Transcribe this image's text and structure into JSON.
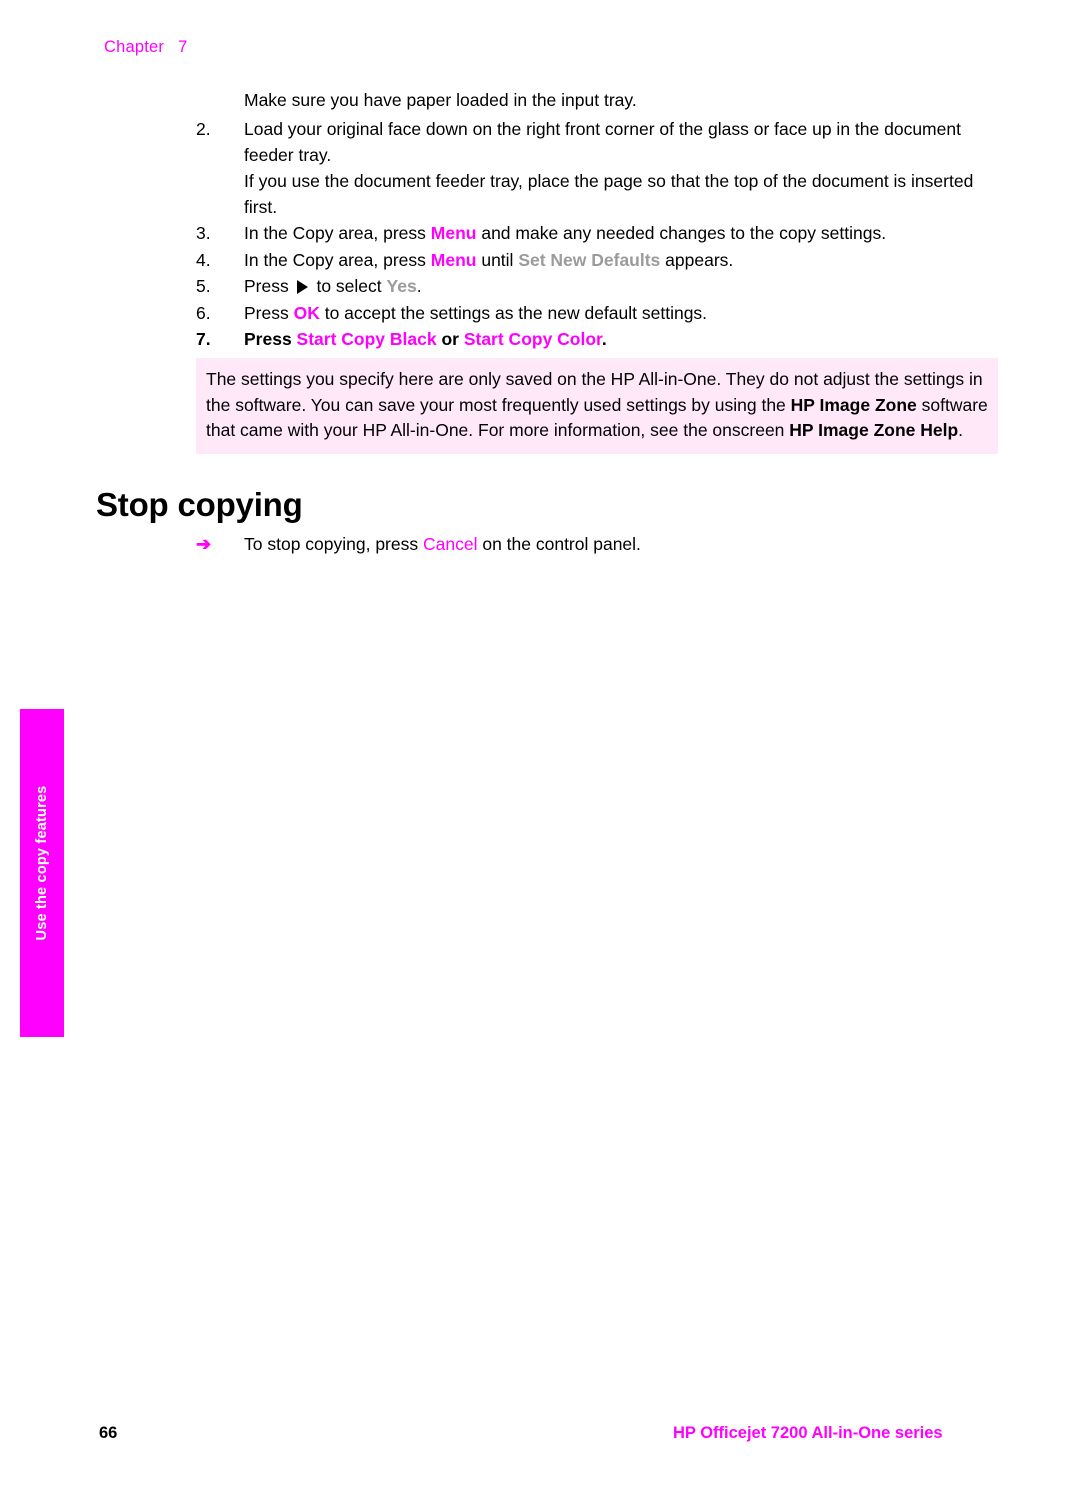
{
  "header": {
    "chapter_label": "Chapter",
    "chapter_number": "7"
  },
  "main": {
    "lead_line": "Make sure you have paper loaded in the input tray.",
    "steps": [
      {
        "marker": "2.",
        "text_before": "Load your original face down on the right front corner of the glass or face up in the document feeder tray.",
        "sub_para": "If you use the document feeder tray, place the page so that the top of the document is inserted first."
      },
      {
        "marker": "3.",
        "pre": "In the Copy area, press ",
        "key": "Menu",
        "post": " and make any needed changes to the copy settings."
      },
      {
        "marker": "4.",
        "pre": "In the Copy area, press ",
        "key": "Menu",
        "mid": " until ",
        "key2": "Set New Defaults",
        "post": " appears."
      },
      {
        "marker": "5.",
        "pre": "Press ",
        "arrow_icon": "right-arrow-key-icon",
        "mid": " to select ",
        "key2": "Yes",
        "post": "."
      },
      {
        "marker": "6.",
        "pre": "Press ",
        "key": "OK",
        "post": " to accept the settings as the new default settings."
      },
      {
        "marker": "7.",
        "pre": "Press ",
        "key": "Start Copy Black",
        "mid": " or ",
        "key2": "Start Copy Color",
        "post": "."
      }
    ]
  },
  "note": {
    "part1": "The settings you specify here are only saved on the HP All-in-One. They do not adjust the settings in the software. You can save your most frequently used settings by using the ",
    "bold1": "HP Image Zone",
    "part2": " software that came with your HP All-in-One. For more information, see the onscreen ",
    "bold2": "HP Image Zone Help",
    "part3": "."
  },
  "section": {
    "heading": "Stop copying",
    "bullet_arrow": "➔",
    "bullet_pre": "To stop copying, press ",
    "bullet_key": "Cancel",
    "bullet_post": " on the control panel."
  },
  "side_tab": {
    "label": "Use the copy features"
  },
  "footer": {
    "page_number": "66",
    "product": "HP Officejet 7200 All-in-One series"
  },
  "colors": {
    "accent_magenta": "#ff00ff",
    "note_background": "#ffe9f9",
    "disabled_gray": "#9b9b9b"
  }
}
